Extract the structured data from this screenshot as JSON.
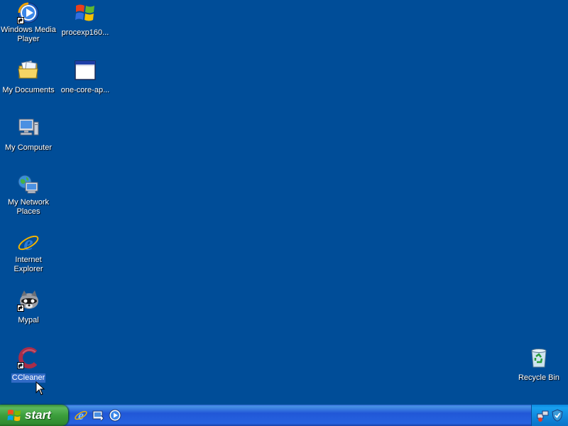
{
  "desktop": {
    "icons": [
      {
        "label": "Windows Media Player",
        "icon": "media-player-icon",
        "shortcut": true
      },
      {
        "label": "procexp160...",
        "icon": "windows-flag-icon",
        "shortcut": false
      },
      {
        "label": "My Documents",
        "icon": "documents-folder-icon",
        "shortcut": false
      },
      {
        "label": "one-core-ap...",
        "icon": "application-window-icon",
        "shortcut": false
      },
      {
        "label": "My Computer",
        "icon": "computer-icon",
        "shortcut": false
      },
      {
        "label": "My Network Places",
        "icon": "network-places-icon",
        "shortcut": false
      },
      {
        "label": "Internet Explorer",
        "icon": "internet-explorer-icon",
        "shortcut": false
      },
      {
        "label": "Mypal",
        "icon": "mypal-icon",
        "shortcut": true
      },
      {
        "label": "CCleaner",
        "icon": "ccleaner-icon",
        "shortcut": true,
        "selected": true
      },
      {
        "label": "Recycle Bin",
        "icon": "recycle-bin-icon",
        "shortcut": false
      }
    ]
  },
  "taskbar": {
    "start_label": "start",
    "quick_launch": [
      "internet-explorer-icon",
      "show-desktop-icon",
      "media-player-icon"
    ],
    "tray": [
      "network-icon",
      "security-icon"
    ]
  },
  "colors": {
    "desktop_bg": "#004d98",
    "taskbar_blue": "#2663e0",
    "start_green": "#3c9e3c",
    "selection": "#316ac5"
  }
}
